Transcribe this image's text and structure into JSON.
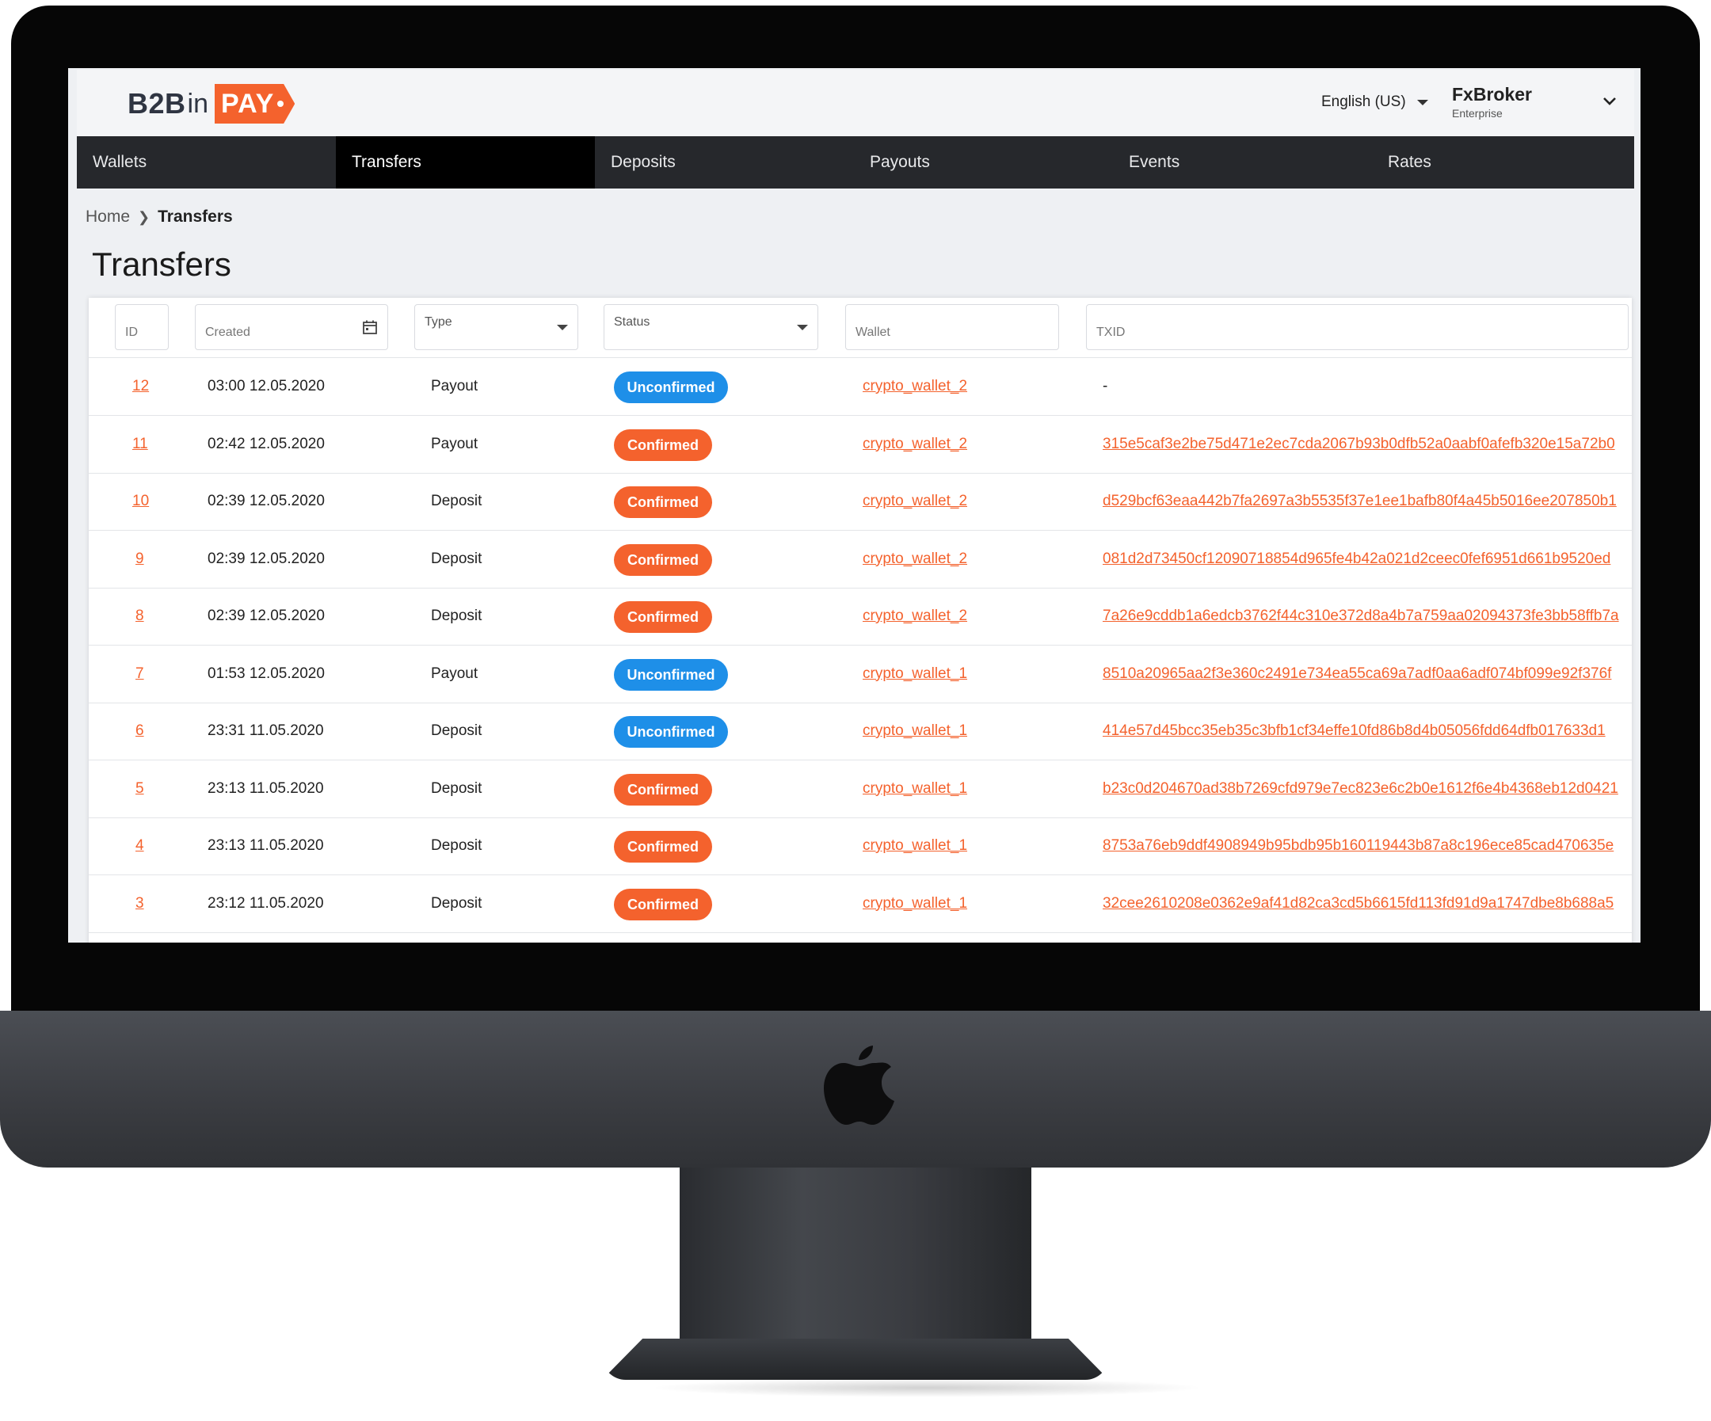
{
  "app": {
    "logo": {
      "b2b": "B2B",
      "in": "in",
      "pay": "PAY"
    },
    "language": "English (US)",
    "user": {
      "name": "FxBroker",
      "role": "Enterprise"
    },
    "accent_color": "#f4622d",
    "info_color": "#1e8fe8"
  },
  "nav": [
    "Wallets",
    "Transfers",
    "Deposits",
    "Payouts",
    "Events",
    "Rates"
  ],
  "nav_active": "Transfers",
  "breadcrumb": {
    "home": "Home",
    "current": "Transfers"
  },
  "page_title": "Transfers",
  "filters": {
    "id": "ID",
    "created": "Created",
    "type": "Type",
    "status": "Status",
    "wallet": "Wallet",
    "txid": "TXID"
  },
  "rows": [
    {
      "id": "12",
      "created": "03:00 12.05.2020",
      "type": "Payout",
      "status": "Unconfirmed",
      "wallet": "crypto_wallet_2",
      "txid": "-"
    },
    {
      "id": "11",
      "created": "02:42 12.05.2020",
      "type": "Payout",
      "status": "Confirmed",
      "wallet": "crypto_wallet_2",
      "txid": "315e5caf3e2be75d471e2ec7cda2067b93b0dfb52a0aabf0afefb320e15a72b0"
    },
    {
      "id": "10",
      "created": "02:39 12.05.2020",
      "type": "Deposit",
      "status": "Confirmed",
      "wallet": "crypto_wallet_2",
      "txid": "d529bcf63eaa442b7fa2697a3b5535f37e1ee1bafb80f4a45b5016ee207850b1"
    },
    {
      "id": "9",
      "created": "02:39 12.05.2020",
      "type": "Deposit",
      "status": "Confirmed",
      "wallet": "crypto_wallet_2",
      "txid": "081d2d73450cf12090718854d965fe4b42a021d2ceec0fef6951d661b9520ed"
    },
    {
      "id": "8",
      "created": "02:39 12.05.2020",
      "type": "Deposit",
      "status": "Confirmed",
      "wallet": "crypto_wallet_2",
      "txid": "7a26e9cddb1a6edcb3762f44c310e372d8a4b7a759aa02094373fe3bb58ffb7a"
    },
    {
      "id": "7",
      "created": "01:53 12.05.2020",
      "type": "Payout",
      "status": "Unconfirmed",
      "wallet": "crypto_wallet_1",
      "txid": "8510a20965aa2f3e360c2491e734ea55ca69a7adf0aa6adf074bf099e92f376f"
    },
    {
      "id": "6",
      "created": "23:31 11.05.2020",
      "type": "Deposit",
      "status": "Unconfirmed",
      "wallet": "crypto_wallet_1",
      "txid": "414e57d45bcc35eb35c3bfb1cf34effe10fd86b8d4b05056fdd64dfb017633d1"
    },
    {
      "id": "5",
      "created": "23:13 11.05.2020",
      "type": "Deposit",
      "status": "Confirmed",
      "wallet": "crypto_wallet_1",
      "txid": "b23c0d204670ad38b7269cfd979e7ec823e6c2b0e1612f6e4b4368eb12d0421"
    },
    {
      "id": "4",
      "created": "23:13 11.05.2020",
      "type": "Deposit",
      "status": "Confirmed",
      "wallet": "crypto_wallet_1",
      "txid": "8753a76eb9ddf4908949b95bdb95b160119443b87a8c196ece85cad470635e"
    },
    {
      "id": "3",
      "created": "23:12 11.05.2020",
      "type": "Deposit",
      "status": "Confirmed",
      "wallet": "crypto_wallet_1",
      "txid": "32cee2610208e0362e9af41d82ca3cd5b6615fd113fd91d9a1747dbe8b688a5"
    }
  ]
}
